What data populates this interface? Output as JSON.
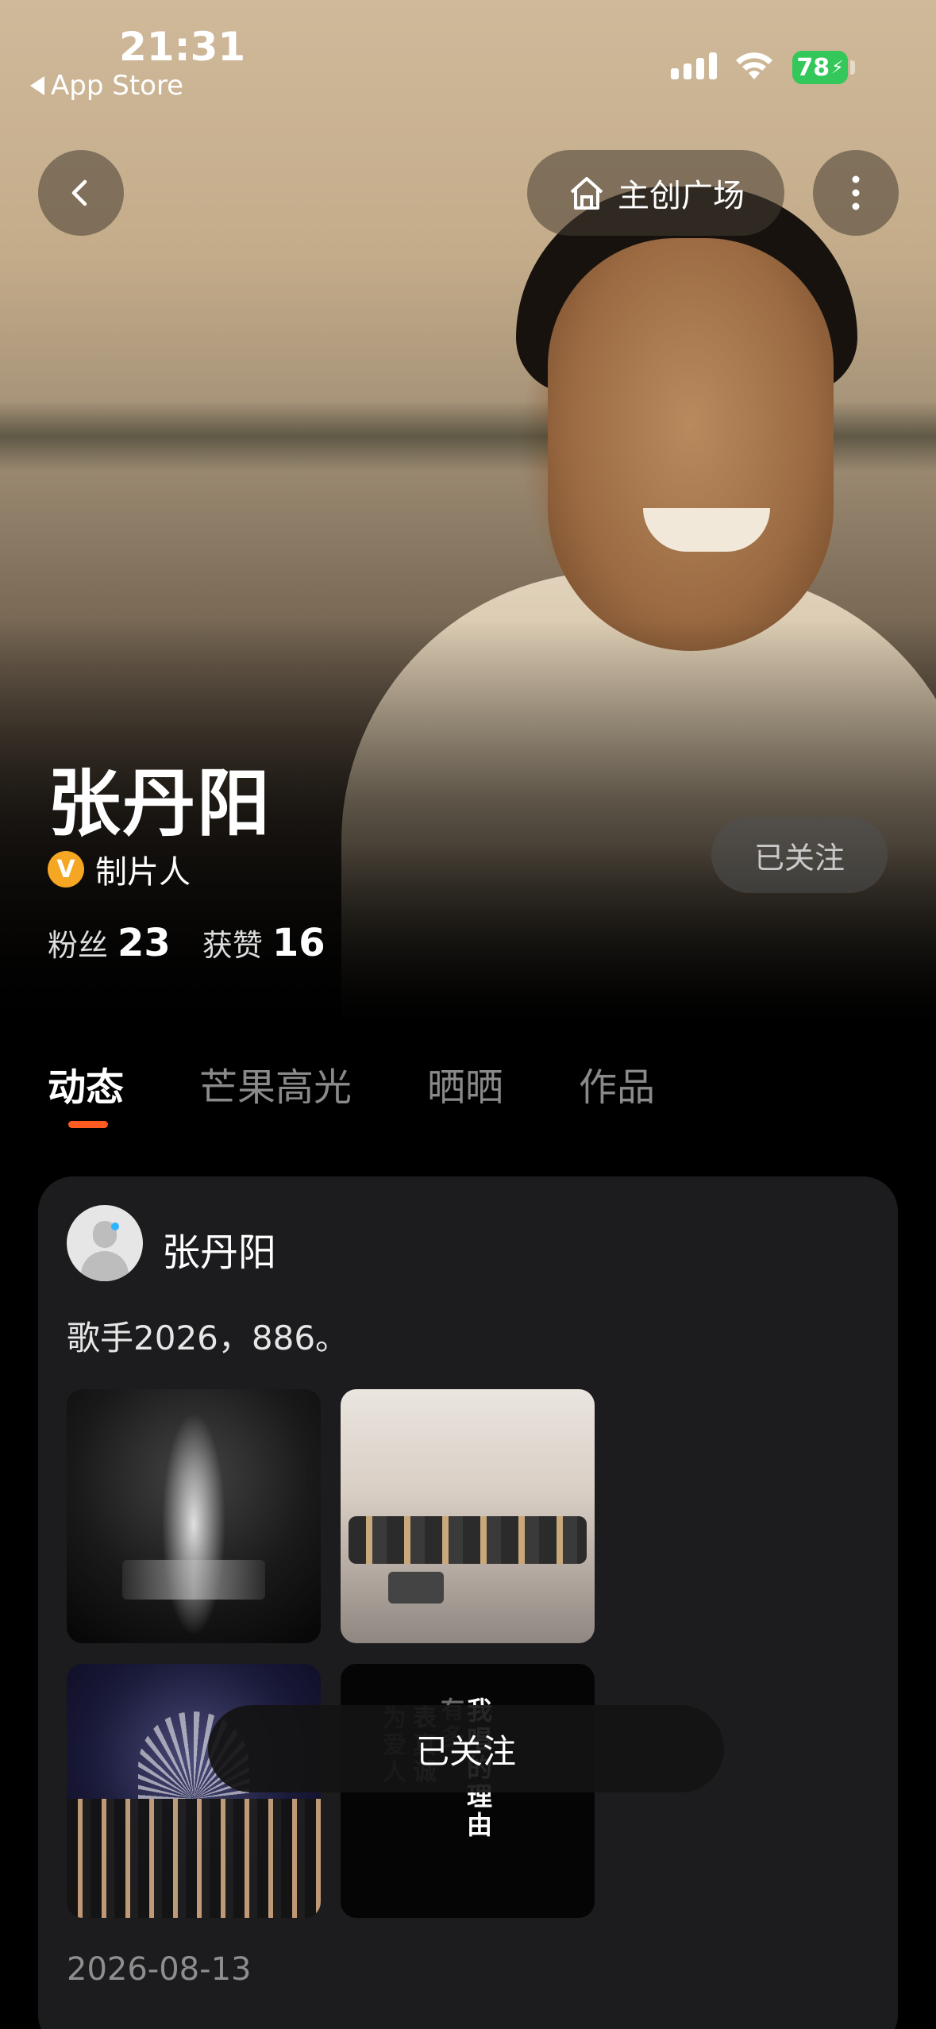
{
  "status_bar": {
    "time": "21:31",
    "back_app": "App Store",
    "battery": "78"
  },
  "nav": {
    "back_icon": "chevron-left-icon",
    "plaza_label": "主创广场",
    "plaza_icon": "home-icon",
    "more_icon": "more-vertical-icon"
  },
  "profile": {
    "name": "张丹阳",
    "verified_badge": "V",
    "role": "制片人",
    "follow_label": "已关注",
    "fans_label": "粉丝",
    "fans_count": "23",
    "likes_label": "获赞",
    "likes_count": "16"
  },
  "tabs": [
    {
      "label": "动态",
      "active": true
    },
    {
      "label": "芒果高光",
      "active": false
    },
    {
      "label": "晒晒",
      "active": false
    },
    {
      "label": "作品",
      "active": false
    }
  ],
  "post": {
    "author": "张丹阳",
    "text": "歌手2026，886。",
    "date": "2026-08-13",
    "image4_lines": [
      "我",
      "有",
      "表",
      "为",
      "多",
      "的",
      "理",
      "由",
      "真",
      "诚",
      "爱",
      "人",
      "唱"
    ]
  },
  "toast": {
    "text": "已关注"
  },
  "colors": {
    "accent": "#ff5a1f",
    "badge": "#f5a623",
    "battery": "#34c759",
    "card_bg": "#1c1c1e"
  }
}
